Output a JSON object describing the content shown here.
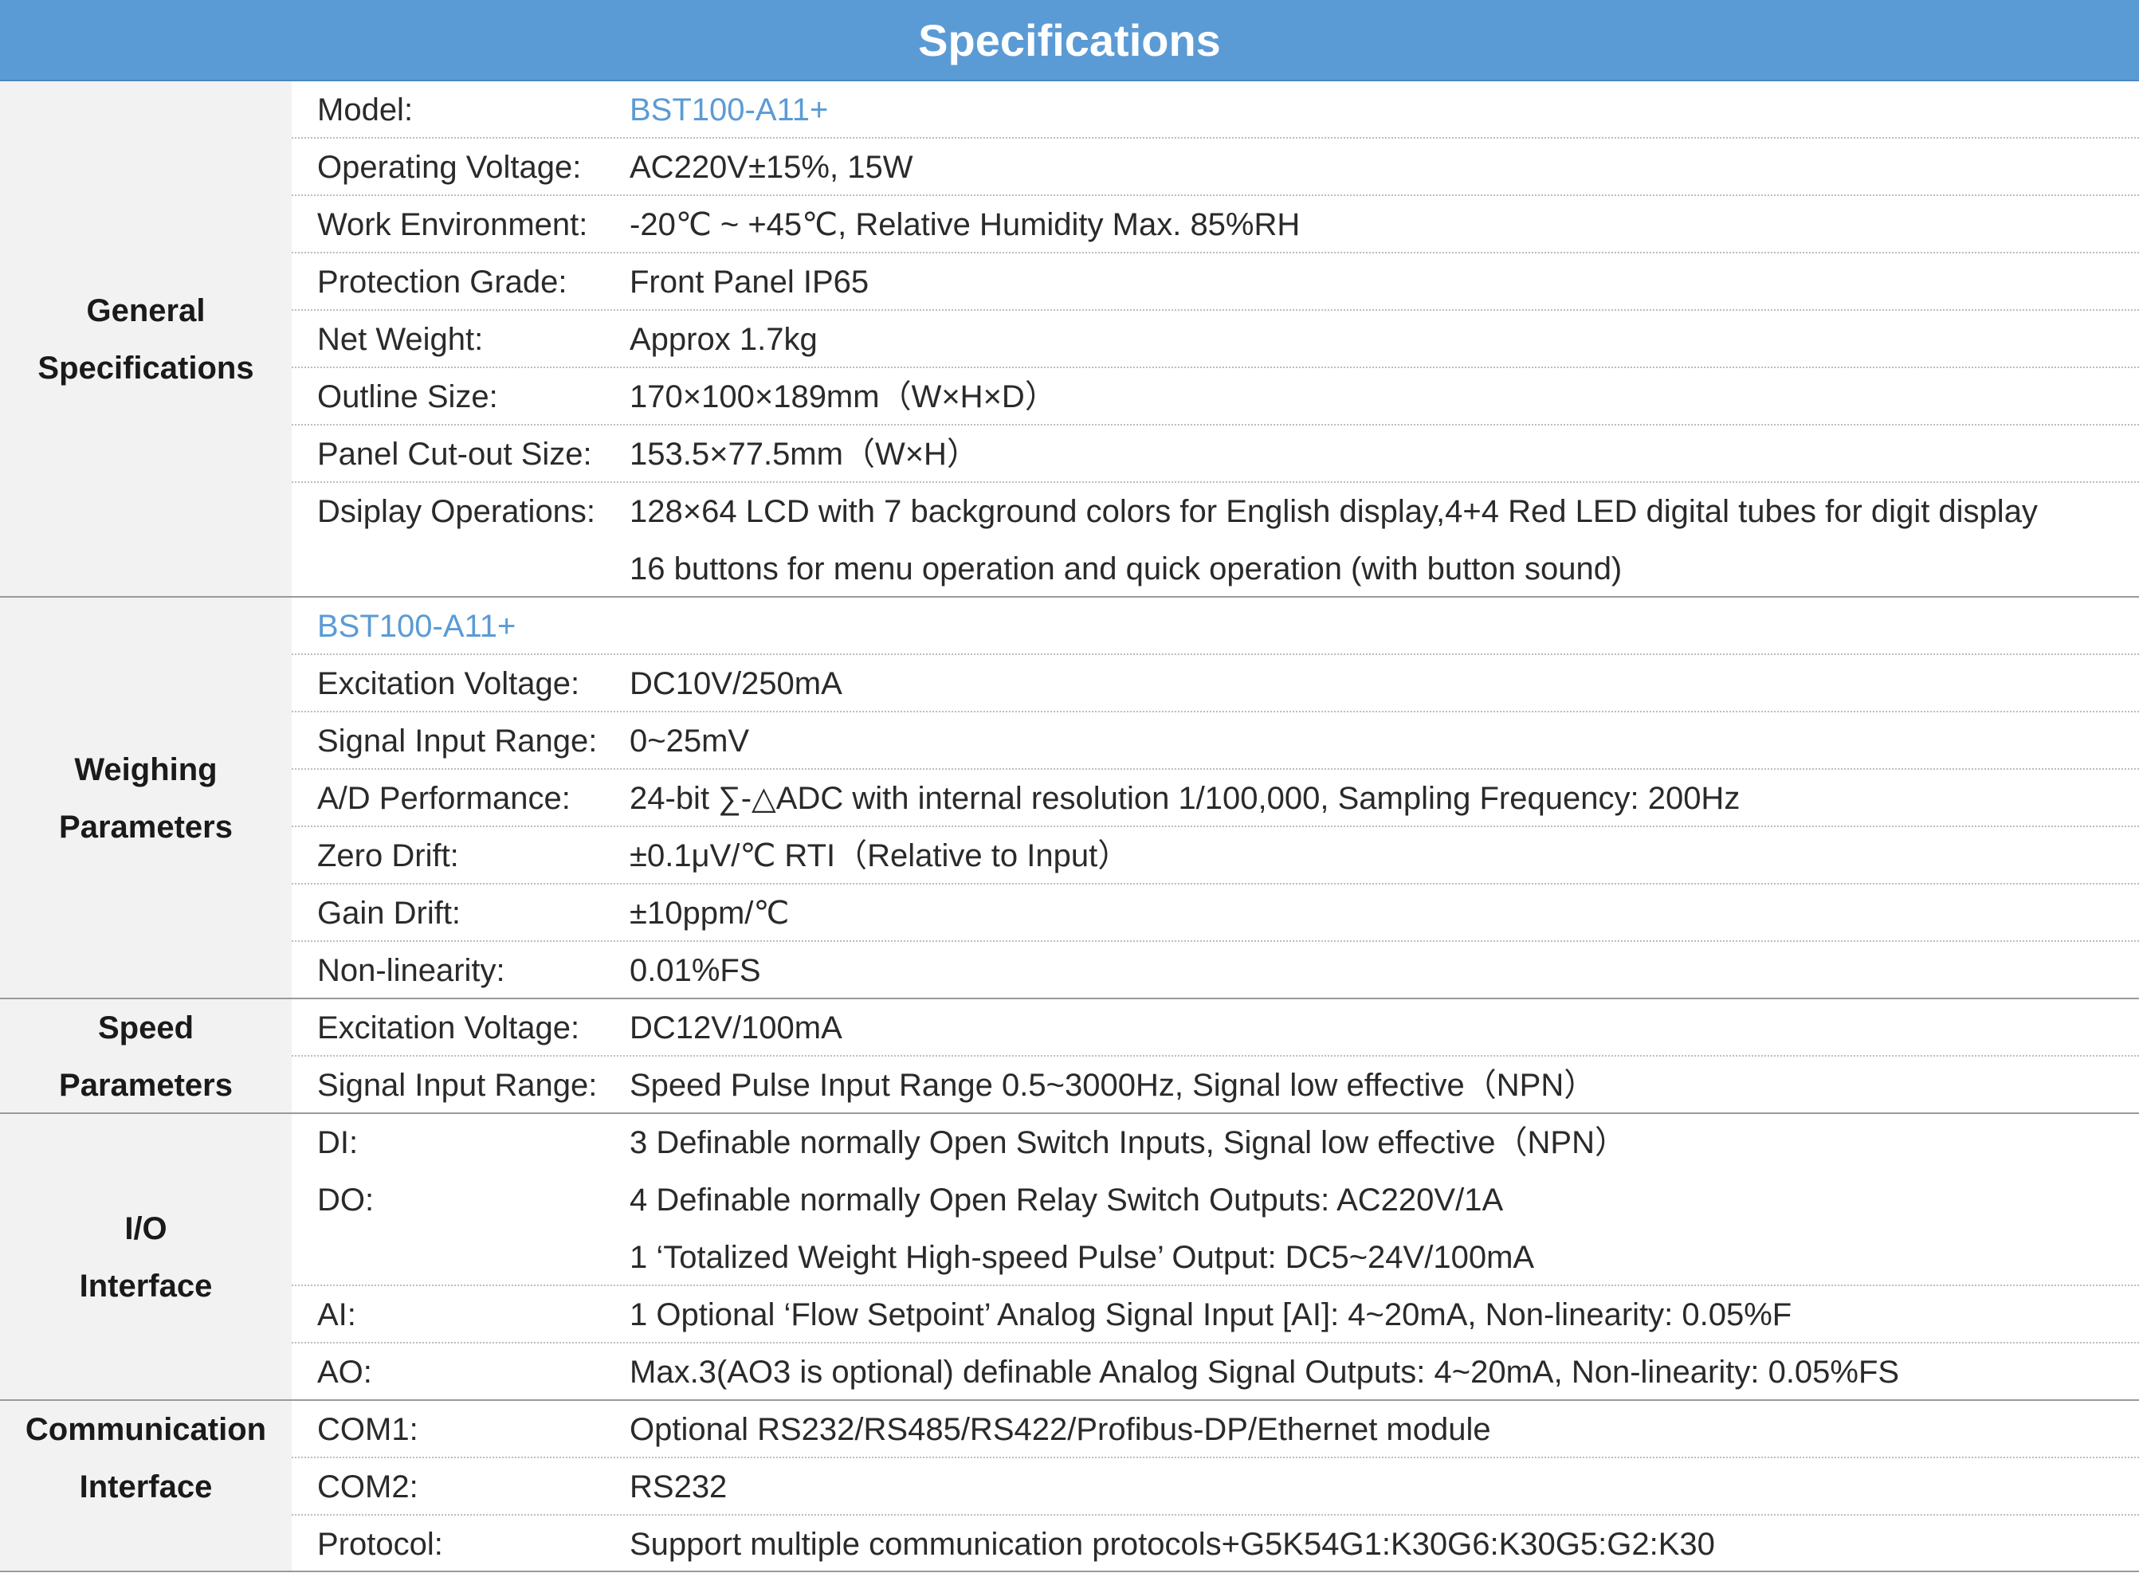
{
  "title": "Specifications",
  "colors": {
    "title_bg": "#5b9bd5",
    "label_bg": "#f2f2f2",
    "model_text": "#5b9bd5"
  },
  "sections": {
    "general": {
      "label_line1": "General",
      "label_line2": "Specifications",
      "rows": [
        {
          "label": "Model:",
          "value": "BST100-A11+"
        },
        {
          "label": "Operating Voltage:",
          "value": "AC220V±15%,  15W"
        },
        {
          "label": "Work Environment:",
          "value": "-20℃ ~ +45℃, Relative Humidity Max. 85%RH"
        },
        {
          "label": "Protection Grade:",
          "value": "Front Panel  IP65"
        },
        {
          "label": "Net Weight:",
          "value": "Approx  1.7kg"
        },
        {
          "label": "Outline Size:",
          "value": "170×100×189mm（W×H×D）"
        },
        {
          "label": "Panel Cut-out Size:",
          "value": " 153.5×77.5mm（W×H）"
        },
        {
          "label": "Dsiplay Operations:",
          "value": "128×64 LCD  with 7 background colors for English display,4+4 Red LED digital tubes for digit display",
          "value2": "16 buttons for menu operation and quick operation (with button sound)"
        }
      ]
    },
    "weighing": {
      "label_line1": "Weighing",
      "label_line2": "Parameters",
      "model": "BST100-A11+",
      "rows": [
        {
          "label": "Excitation Voltage:",
          "value": "DC10V/250mA"
        },
        {
          "label": "Signal Input Range:",
          "value": "0~25mV"
        },
        {
          "label": "A/D Performance:",
          "value": "24-bit ∑-△ADC with internal resolution 1/100,000,  Sampling Frequency: 200Hz"
        },
        {
          "label": "Zero Drift:",
          "value": "±0.1μV/℃ RTI（Relative to Input）"
        },
        {
          "label": "Gain Drift:",
          "value": "±10ppm/℃"
        },
        {
          "label": "Non-linearity:",
          "value": "0.01%FS"
        }
      ]
    },
    "speed": {
      "label_line1": "Speed",
      "label_line2": "Parameters",
      "rows": [
        {
          "label": "Excitation Voltage:",
          "value": "DC12V/100mA"
        },
        {
          "label": "Signal Input Range:",
          "value": "Speed Pulse Input Range  0.5~3000Hz,  Signal low effective（NPN）"
        }
      ]
    },
    "io": {
      "label_line1": "I/O",
      "label_line2": "Interface",
      "rows": [
        {
          "label": "DI:",
          "value": "3 Definable normally Open Switch Inputs,  Signal low effective（NPN）"
        },
        {
          "label": "DO:",
          "value": "4 Definable normally Open Relay Switch Outputs:  AC220V/1A",
          "value2": "1 ‘Totalized Weight High-speed Pulse’ Output:  DC5~24V/100mA"
        },
        {
          "label": "AI:",
          "value": "1 Optional ‘Flow Setpoint’ Analog Signal Input [AI]: 4~20mA, Non-linearity: 0.05%F"
        },
        {
          "label": "AO:",
          "value": "Max.3(AO3 is optional) definable Analog Signal Outputs: 4~20mA, Non-linearity: 0.05%FS"
        }
      ]
    },
    "comm": {
      "label_line1": "Communication",
      "label_line2": "Interface",
      "rows": [
        {
          "label": "COM1:",
          "value": "Optional RS232/RS485/RS422/Profibus-DP/Ethernet module"
        },
        {
          "label": "COM2:",
          "value": "RS232"
        },
        {
          "label": "Protocol:",
          "value": "Support multiple communication protocols+G5K54G1:K30G6:K30G5:G2:K30"
        }
      ]
    }
  }
}
